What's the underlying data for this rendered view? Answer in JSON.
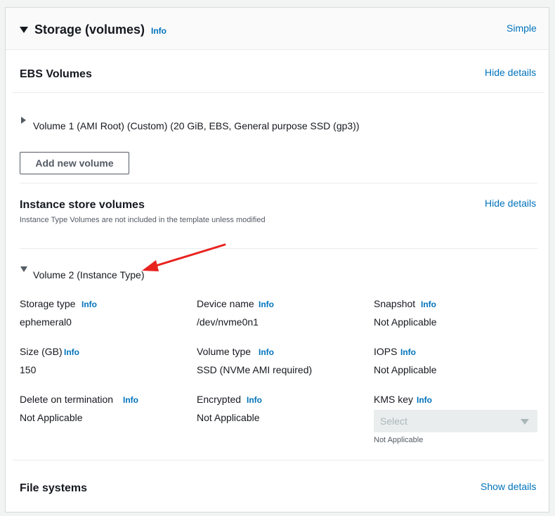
{
  "header": {
    "title": "Storage (volumes)",
    "info": "Info",
    "mode_link": "Simple"
  },
  "ebs": {
    "title": "EBS Volumes",
    "toggle": "Hide details",
    "volume1": "Volume 1 (AMI Root) (Custom) (20 GiB, EBS, General purpose SSD (gp3))",
    "add_button": "Add new volume"
  },
  "instance_store": {
    "title": "Instance store volumes",
    "toggle": "Hide details",
    "subtitle": "Instance Type Volumes are not included in the template unless modified",
    "volume2": "Volume 2 (Instance Type)",
    "fields": {
      "storage_type": {
        "label": "Storage type",
        "info": "Info",
        "value": "ephemeral0"
      },
      "device_name": {
        "label": "Device name",
        "info": "Info",
        "value": "/dev/nvme0n1"
      },
      "snapshot": {
        "label": "Snapshot",
        "info": "Info",
        "value": "Not Applicable"
      },
      "size": {
        "label": "Size (GB)",
        "info": "Info",
        "value": "150"
      },
      "volume_type": {
        "label": "Volume type",
        "info": "Info",
        "value": "SSD (NVMe AMI required)"
      },
      "iops": {
        "label": "IOPS",
        "info": "Info",
        "value": "Not Applicable"
      },
      "delete_on_termination": {
        "label": "Delete on termination",
        "info": "Info",
        "value": "Not Applicable"
      },
      "encrypted": {
        "label": "Encrypted",
        "info": "Info",
        "value": "Not Applicable"
      },
      "kms_key": {
        "label": "KMS key",
        "info": "Info",
        "placeholder": "Select",
        "note": "Not Applicable"
      }
    }
  },
  "file_systems": {
    "title": "File systems",
    "toggle": "Show details"
  },
  "colors": {
    "link": "#0073bb",
    "annotation_arrow": "#e8231f"
  }
}
